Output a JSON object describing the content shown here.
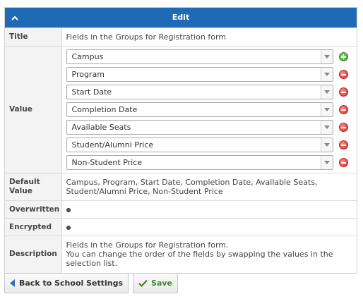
{
  "header": {
    "title": "Edit"
  },
  "rows": {
    "title": {
      "label": "Title",
      "value": "Fields in the Groups for Registration form"
    },
    "value": {
      "label": "Value",
      "selects": [
        "Campus",
        "Program",
        "Start Date",
        "Completion Date",
        "Available Seats",
        "Student/Alumni Price",
        "Non-Student Price"
      ]
    },
    "default": {
      "label_line1": "Default",
      "label_line2": "Value",
      "value_line1": "Campus, Program, Start Date, Completion Date, Available Seats,",
      "value_line2": "Student/Alumni Price, Non-Student Price"
    },
    "overwritten": {
      "label": "Overwritten"
    },
    "encrypted": {
      "label": "Encrypted"
    },
    "description": {
      "label": "Description",
      "line1": "Fields in the Groups for Registration form.",
      "line2": "You can change the order of the fields by swapping the values in the",
      "line3": "selection list."
    }
  },
  "buttons": {
    "back": "Back to School Settings",
    "save": "Save"
  },
  "icons": {
    "collapse": "chevron-up-icon",
    "add": "plus-circle-icon",
    "remove": "minus-circle-icon",
    "back": "arrow-left-icon",
    "save": "checkmark-icon"
  },
  "colors": {
    "header": "#1f6ab5",
    "add": "#3e9a2c",
    "remove": "#d42a2a",
    "save_text": "#3a8a28",
    "back_arrow": "#2f6fc0"
  }
}
